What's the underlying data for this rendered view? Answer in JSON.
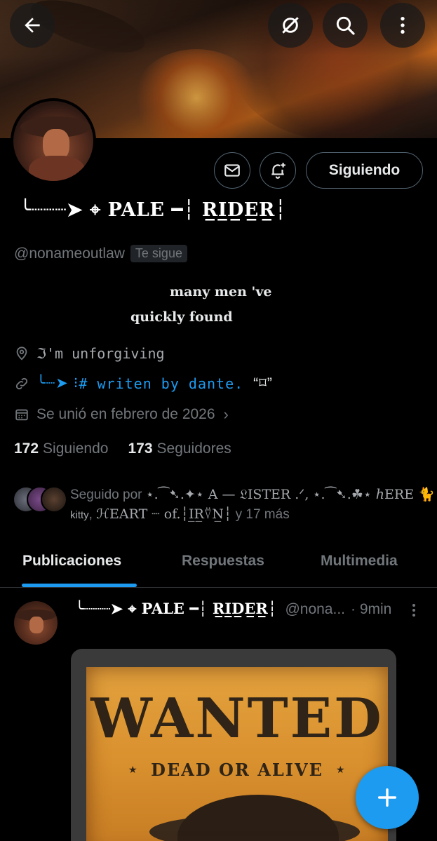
{
  "header": {
    "back_icon": "arrow-left-icon",
    "grok_icon": "slashed-circle-icon",
    "search_icon": "search-icon",
    "more_icon": "more-vertical-icon"
  },
  "profile": {
    "display_name": "╰┈┈┈➤ ⌖ PALE ━┆ R̲I̲D̲E̲R̲┆",
    "handle": "@nonameoutlaw",
    "follows_you": "Te sigue",
    "follow_button": "Siguiendo",
    "bio_line1": "many men 've",
    "bio_line2": "quickly found",
    "location": "ℑ'm unforgiving",
    "link_prefix": "╰┈➤ ⁝ ",
    "link_text": "# writen by dante.",
    "link_quote": "“⌑”",
    "joined": "Se unió en febrero de 2026",
    "following_count": "172",
    "following_label": "Siguiendo",
    "followers_count": "173",
    "followers_label": "Seguidores",
    "followed_by_prefix": "Seguido por ",
    "followed_by_1": "⋆.⁀➷.✦⋆ A — 𝔏ISTER .ᐟ,",
    "followed_by_2": "⋆.⁀➷.☘⋆ ℎERE 🐈",
    "followed_by_3": "kitty",
    "followed_by_4": "ℋEART ┈ of.┆I̲R̲⍢N̲┆",
    "followed_by_more": "y 17 más"
  },
  "tabs": [
    {
      "label": "Publicaciones",
      "active": true
    },
    {
      "label": "Respuestas",
      "active": false
    },
    {
      "label": "Multimedia",
      "active": false
    }
  ],
  "post": {
    "author": "╰┈┈┈➤ ⌖ PALE ━┆ R̲I̲D̲E̲R̲┆",
    "handle": "@nona...",
    "time": "· 9min",
    "image_title": "WANTED",
    "image_subtitle": "DEAD OR ALIVE"
  },
  "colors": {
    "accent": "#1d9bf0",
    "text_primary": "#e7e9ea",
    "text_secondary": "#71767b",
    "background": "#000000"
  }
}
